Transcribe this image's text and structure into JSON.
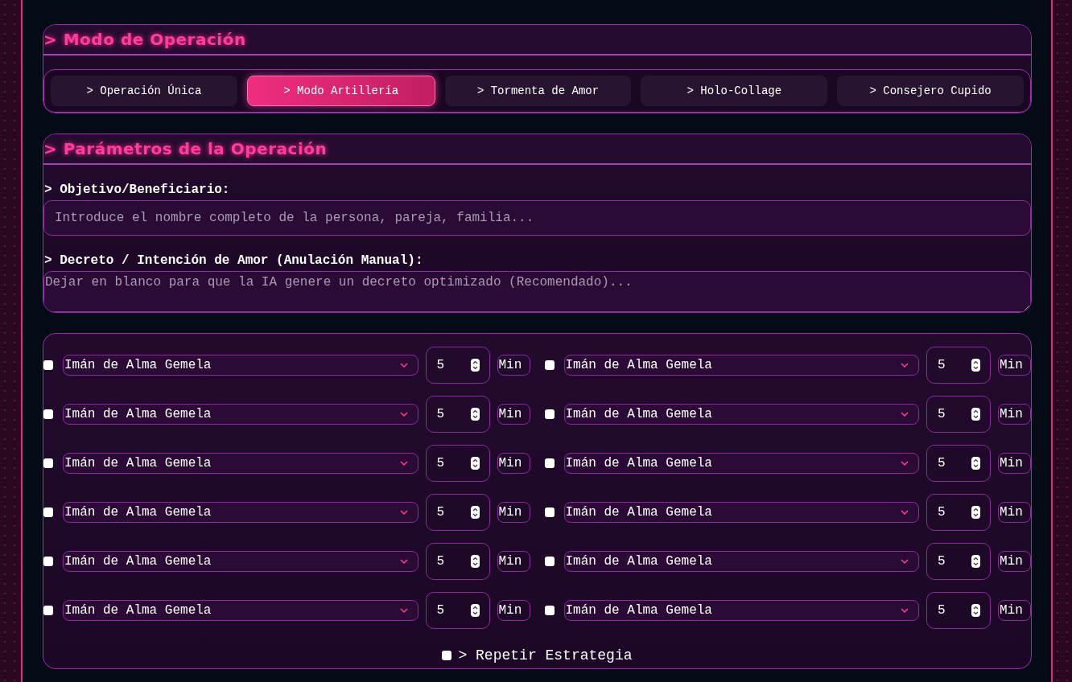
{
  "operation_mode": {
    "title": "> Modo de Operación",
    "tabs": [
      {
        "label": "> Operación Única",
        "selected": false
      },
      {
        "label": "> Modo Artillería",
        "selected": true
      },
      {
        "label": "> Tormenta de Amor",
        "selected": false
      },
      {
        "label": "> Holo-Collage",
        "selected": false
      },
      {
        "label": "> Consejero Cupido",
        "selected": false
      }
    ]
  },
  "parameters": {
    "title": "> Parámetros de la Operación",
    "target": {
      "label": "> Objetivo/Beneficiario:",
      "placeholder": "Introduce el nombre completo de la persona, pareja, familia..."
    },
    "decree": {
      "label": "> Decreto / Intención de Amor (Anulación Manual):",
      "placeholder": "Dejar en blanco para que la IA genere un decreto optimizado (Recomendado)..."
    }
  },
  "strategy": {
    "slots": [
      {
        "checked": false,
        "option": "Imán de Alma Gemela",
        "minutes": "5",
        "unit": "Min"
      },
      {
        "checked": false,
        "option": "Imán de Alma Gemela",
        "minutes": "5",
        "unit": "Min"
      },
      {
        "checked": false,
        "option": "Imán de Alma Gemela",
        "minutes": "5",
        "unit": "Min"
      },
      {
        "checked": false,
        "option": "Imán de Alma Gemela",
        "minutes": "5",
        "unit": "Min"
      },
      {
        "checked": false,
        "option": "Imán de Alma Gemela",
        "minutes": "5",
        "unit": "Min"
      },
      {
        "checked": false,
        "option": "Imán de Alma Gemela",
        "minutes": "5",
        "unit": "Min"
      },
      {
        "checked": false,
        "option": "Imán de Alma Gemela",
        "minutes": "5",
        "unit": "Min"
      },
      {
        "checked": false,
        "option": "Imán de Alma Gemela",
        "minutes": "5",
        "unit": "Min"
      },
      {
        "checked": false,
        "option": "Imán de Alma Gemela",
        "minutes": "5",
        "unit": "Min"
      },
      {
        "checked": false,
        "option": "Imán de Alma Gemela",
        "minutes": "5",
        "unit": "Min"
      },
      {
        "checked": false,
        "option": "Imán de Alma Gemela",
        "minutes": "5",
        "unit": "Min"
      },
      {
        "checked": false,
        "option": "Imán de Alma Gemela",
        "minutes": "5",
        "unit": "Min"
      }
    ],
    "repeat": {
      "label": "> Repetir Estrategia",
      "checked": false
    }
  }
}
